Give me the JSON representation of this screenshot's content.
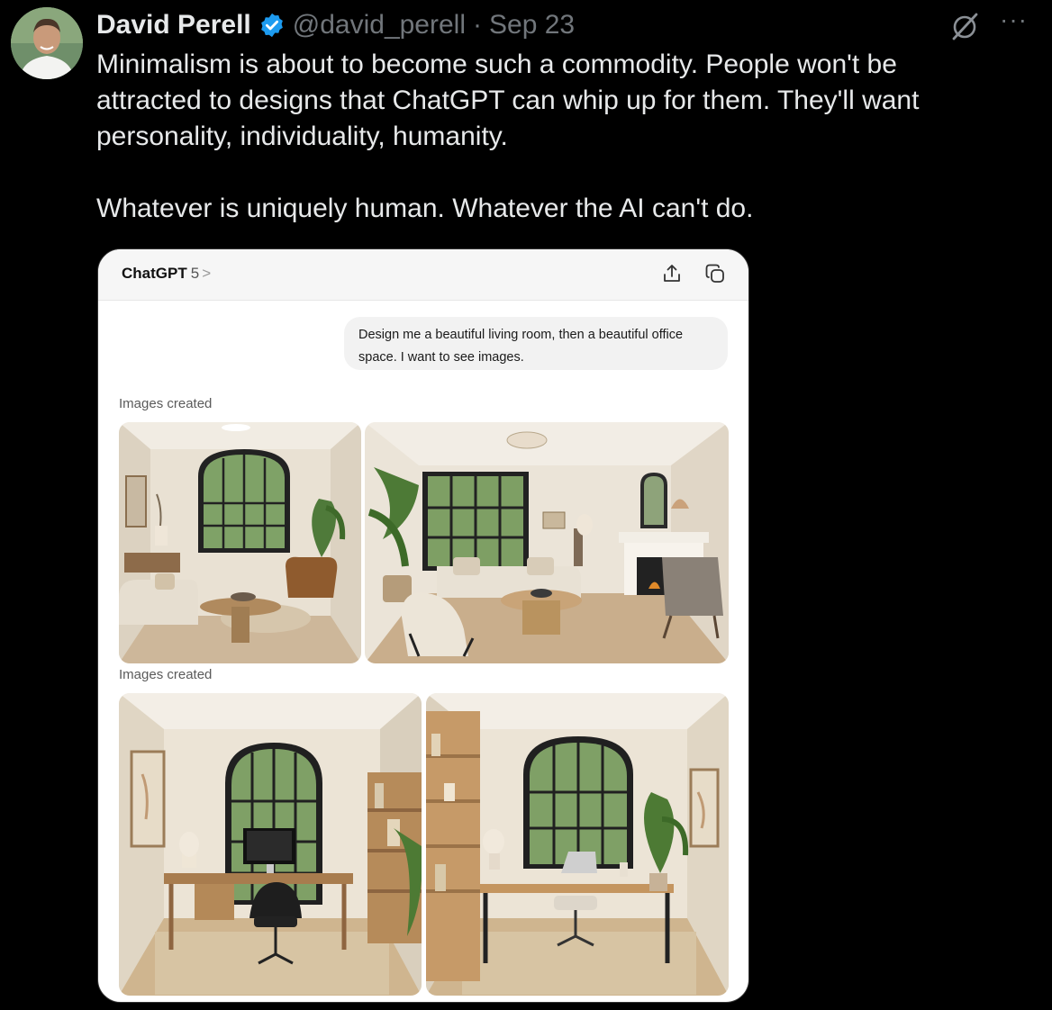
{
  "tweet": {
    "author_name": "David Perell",
    "handle": "@david_perell",
    "separator": "·",
    "date": "Sep 23",
    "text_para1": "Minimalism is about to become such a commodity. People won't be attracted to designs that ChatGPT can whip up for them. They'll want personality, individuality, humanity.",
    "text_para2": "Whatever is uniquely human. Whatever the AI can't do.",
    "more_label": "···"
  },
  "chat": {
    "model_name": "ChatGPT",
    "model_version": "5",
    "model_chevron": ">",
    "prompt": "Design me a beautiful living room, then a beautiful office space. I want to see images.",
    "section1_label": "Images created",
    "section2_label": "Images created"
  },
  "colors": {
    "background": "#000000",
    "text": "#e7e9ea",
    "muted": "#71767b",
    "verified": "#1d9bf0"
  },
  "icons": [
    "verified-badge-icon",
    "grok-icon",
    "more-icon",
    "share-icon",
    "new-chat-icon"
  ]
}
